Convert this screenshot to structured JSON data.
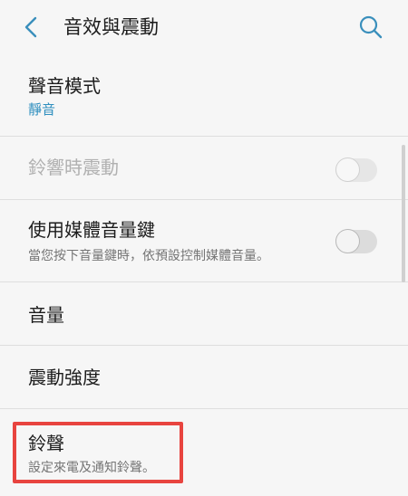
{
  "header": {
    "title": "音效與震動",
    "back_icon": "chevron-left-icon",
    "search_icon": "search-icon"
  },
  "items": [
    {
      "label": "聲音模式",
      "sub": "靜音"
    },
    {
      "label": "鈴響時震動",
      "toggle": false,
      "disabled": true
    },
    {
      "label": "使用媒體音量鍵",
      "sub": "當您按下音量鍵時，依預設控制媒體音量。",
      "toggle": false
    },
    {
      "label": "音量"
    },
    {
      "label": "震動強度"
    },
    {
      "label": "鈴聲",
      "sub": "設定來電及通知鈴聲。"
    }
  ],
  "colors": {
    "accent": "#2f8fbf",
    "highlight": "#e8443f",
    "background": "#f6f6f6"
  }
}
